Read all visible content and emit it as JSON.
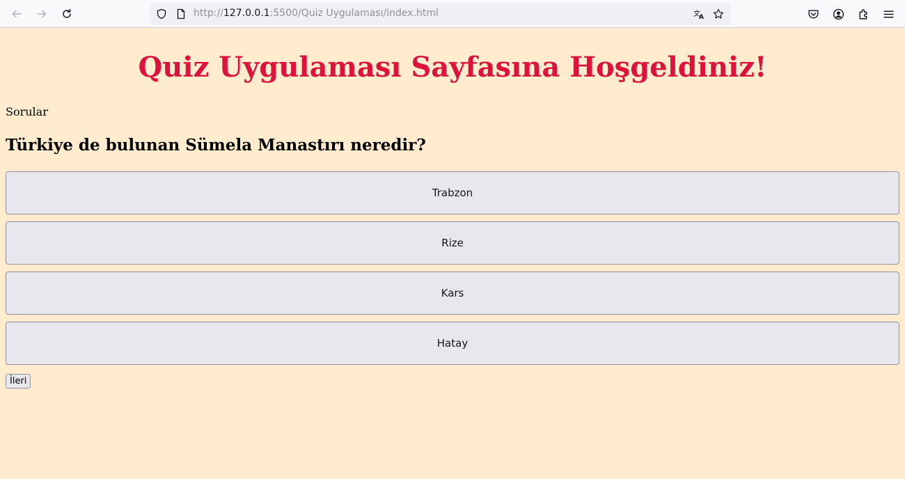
{
  "browser": {
    "url_prefix": "http://",
    "url_host": "127.0.0.1",
    "url_rest": ":5500/Quiz Uygulaması/index.html"
  },
  "page": {
    "title": "Quiz Uygulaması Sayfasına Hoşgeldiniz!",
    "section_label": "Sorular",
    "question": "Türkiye de bulunan Sümela Manastırı neredir?",
    "answers": [
      "Trabzon",
      "Rize",
      "Kars",
      "Hatay"
    ],
    "next_label": "İleri"
  },
  "colors": {
    "background": "#ffebcd",
    "title": "#dc143c",
    "answer_bg": "#e9e7ed"
  }
}
